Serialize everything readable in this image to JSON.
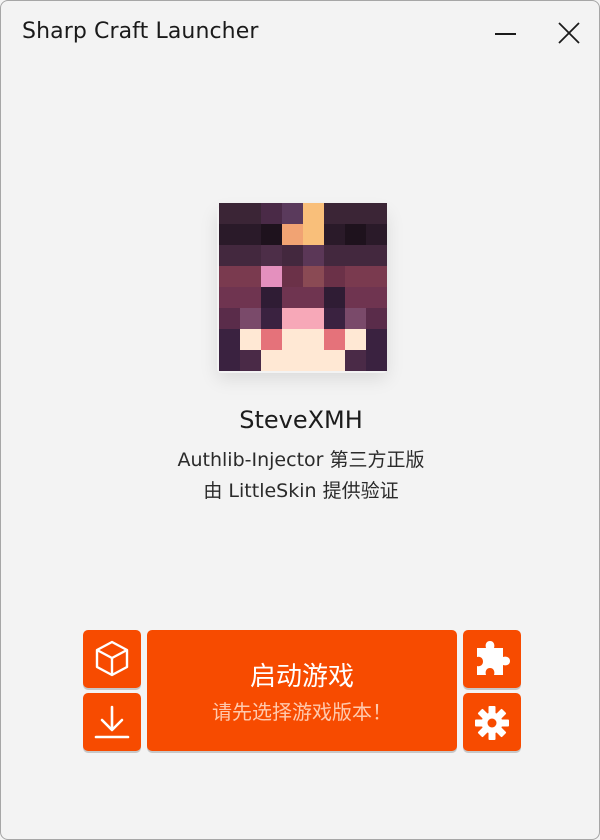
{
  "window": {
    "title": "Sharp Craft Launcher",
    "minimize_icon": "minimize-icon",
    "close_icon": "close-icon"
  },
  "account": {
    "avatar_icon": "player-head-avatar",
    "username": "SteveXMH",
    "auth_type": "Authlib-Injector 第三方正版",
    "auth_provider": "由 LittleSkin 提供验证"
  },
  "actions": {
    "version_icon": "cube-icon",
    "download_icon": "download-icon",
    "mods_icon": "puzzle-icon",
    "settings_icon": "gear-icon",
    "launch_label": "启动游戏",
    "launch_hint": "请先选择游戏版本！"
  },
  "colors": {
    "accent": "#f74b00",
    "background": "#f3f3f3",
    "hint_text": "#ffc9ad"
  }
}
